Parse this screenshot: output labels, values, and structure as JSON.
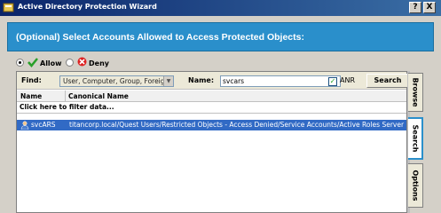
{
  "window": {
    "title": "Active Directory Protection Wizard",
    "buttons": [
      "?",
      "X"
    ]
  },
  "banner": {
    "text": "(Optional) Select Accounts Allowed to Access Protected Objects:",
    "color": "#2a8fcb"
  },
  "access": {
    "allow_label": "Allow",
    "deny_label": "Deny",
    "selected": "Allow"
  },
  "search": {
    "find_label": "Find:",
    "find_value": "User, Computer, Group, Foreign",
    "name_label": "Name:",
    "name_value": "svcars",
    "anr_label": "ANR",
    "anr_checked": true,
    "search_button": "Search"
  },
  "results": {
    "columns": [
      "Name",
      "Canonical Name"
    ],
    "filter_row": "Click here to filter data...",
    "rows": [
      {
        "name": "svcARS",
        "canonical_name": "titancorp.local/Quest Users/Restricted Objects - Access Denied/Service Accounts/Active Roles Server Us",
        "icon": "user-icon"
      }
    ]
  },
  "side_tabs": [
    "Browse",
    "Search",
    "Options"
  ],
  "active_tab": "Search",
  "selection_color": "#316ac5"
}
